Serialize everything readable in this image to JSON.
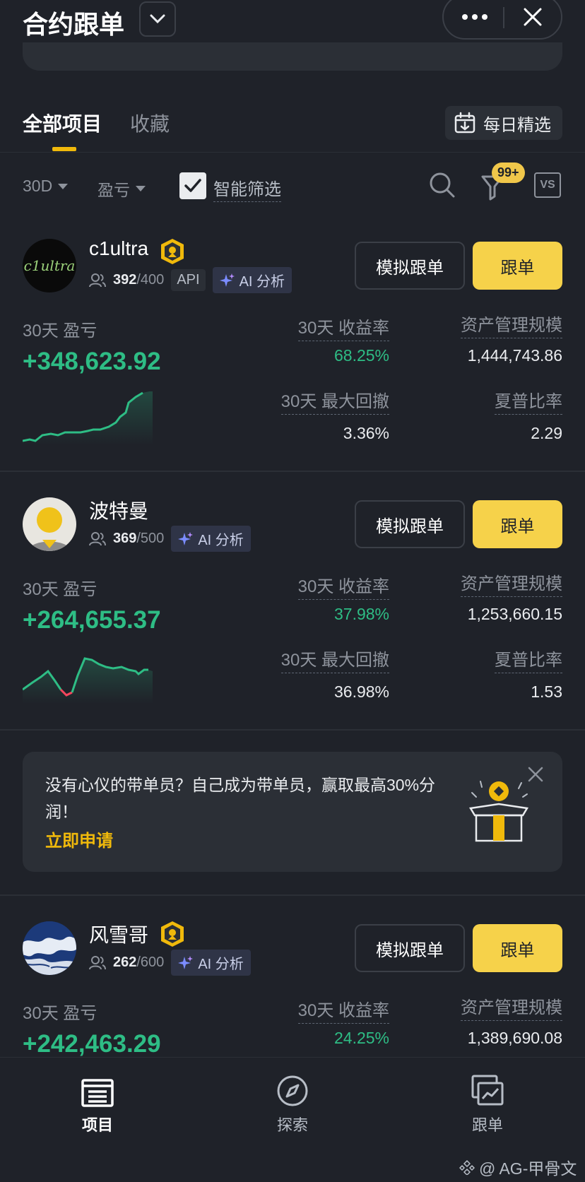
{
  "header": {
    "title": "合约跟单"
  },
  "tabs": {
    "all": "全部项目",
    "favorites": "收藏",
    "daily": "每日精选"
  },
  "filters": {
    "period": "30D",
    "sort": "盈亏",
    "smart": "智能筛选",
    "filter_badge": "99+",
    "vs": "VS"
  },
  "labels": {
    "pnl": "30天 盈亏",
    "roi": "30天 收益率",
    "aum": "资产管理规模",
    "mdd": "30天 最大回撤",
    "sharpe": "夏普比率",
    "simulate": "模拟跟单",
    "copy": "跟单",
    "ai": "AI 分析",
    "api": "API"
  },
  "traders": [
    {
      "name": "c1ultra",
      "followers": "392",
      "max_followers": "/400",
      "pnl": "+348,623.92",
      "roi": "68.25%",
      "aum": "1,444,743.86",
      "mdd": "3.36%",
      "sharpe": "2.29",
      "has_api": true,
      "has_medal": true
    },
    {
      "name": "波特曼",
      "followers": "369",
      "max_followers": "/500",
      "pnl": "+264,655.37",
      "roi": "37.98%",
      "aum": "1,253,660.15",
      "mdd": "36.98%",
      "sharpe": "1.53",
      "has_api": false,
      "has_medal": false
    },
    {
      "name": "风雪哥",
      "followers": "262",
      "max_followers": "/600",
      "pnl": "+242,463.29",
      "roi": "24.25%",
      "aum": "1,389,690.08",
      "has_api": false,
      "has_medal": true
    }
  ],
  "avatar_text": {
    "c1ultra": "c1ultra"
  },
  "promo": {
    "text": "没有心仪的带单员？自己成为带单员，赢取最高30%分润！",
    "link": "立即申请"
  },
  "nav": {
    "projects": "项目",
    "explore": "探索",
    "copy": "跟单"
  },
  "watermark": "@ AG-甲骨文",
  "colors": {
    "accent": "#f0b90b",
    "green": "#2ebd85",
    "red": "#f6465d",
    "bg": "#1f2229",
    "button_yellow": "#f6d24a"
  }
}
